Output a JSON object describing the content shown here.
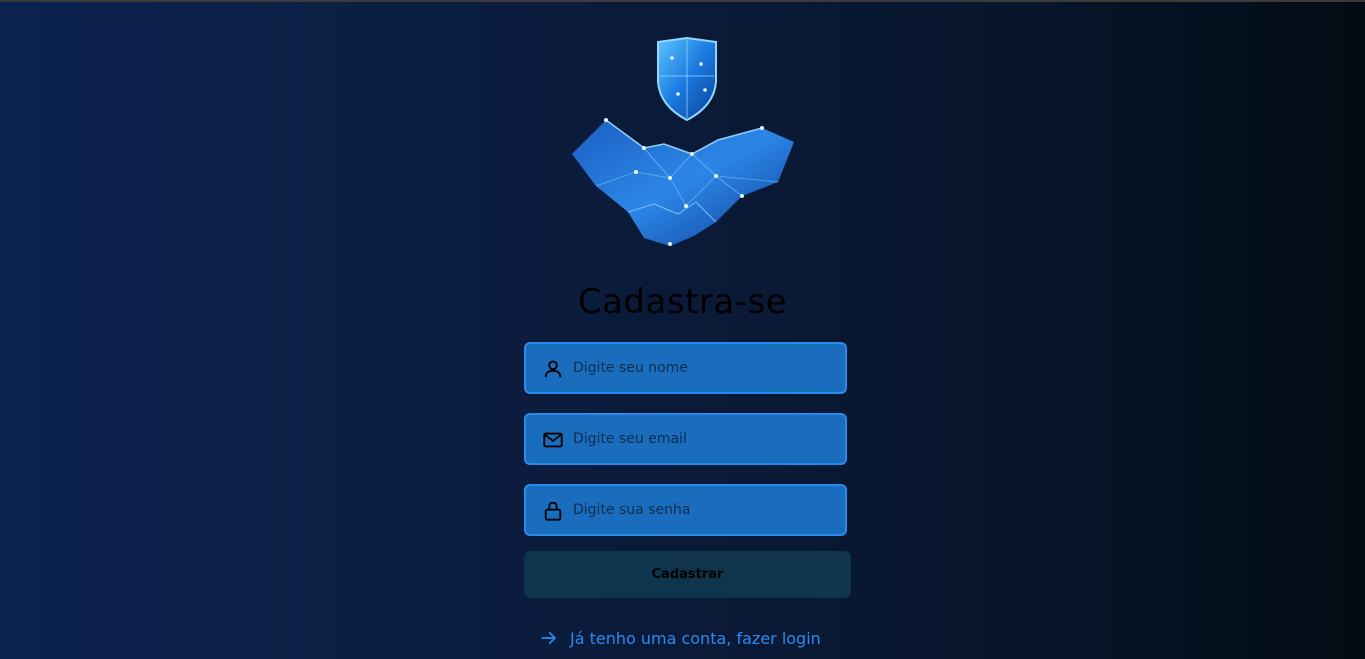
{
  "page": {
    "title": "Cadastra-se"
  },
  "form": {
    "name_placeholder": "Digite seu nome",
    "email_placeholder": "Digite seu email",
    "password_placeholder": "Digite sua senha",
    "submit_label": "Cadastrar"
  },
  "footer": {
    "login_link_label": "Já tenho uma conta, fazer login"
  },
  "icons": {
    "logo": "shield-handshake-icon",
    "name": "user-icon",
    "email": "mail-icon",
    "password": "lock-icon",
    "link": "arrow-right-icon"
  },
  "colors": {
    "field_background": "#1a6dbd",
    "field_border": "#2a8bec",
    "button_background": "#0f344d",
    "link": "#2b8bf0"
  }
}
